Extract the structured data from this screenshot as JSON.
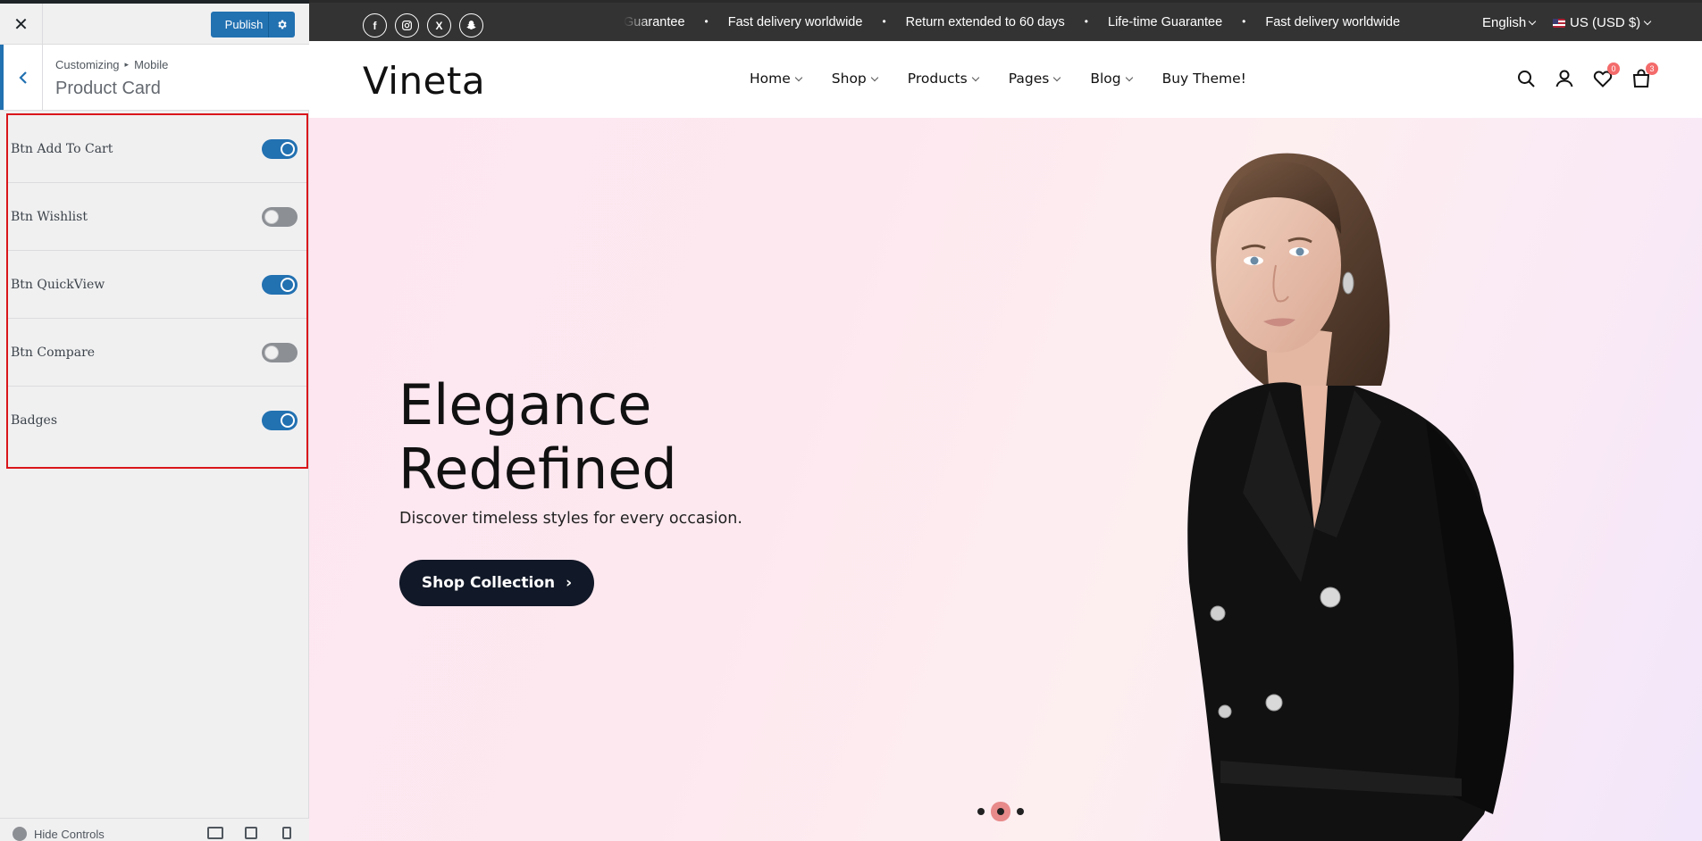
{
  "sidebar": {
    "close_label": "✕",
    "publish_label": "Publish",
    "breadcrumb": {
      "root": "Customizing",
      "separator": "▸",
      "current": "Mobile"
    },
    "section_title": "Product Card",
    "controls": [
      {
        "label": "Btn Add To Cart",
        "checked": true
      },
      {
        "label": "Btn Wishlist",
        "checked": false
      },
      {
        "label": "Btn QuickView",
        "checked": true
      },
      {
        "label": "Btn Compare",
        "checked": false
      },
      {
        "label": "Badges",
        "checked": true
      }
    ],
    "footer": {
      "hide_controls": "Hide Controls"
    },
    "colors": {
      "accent": "#2271b1",
      "highlight_border": "#d9161b"
    }
  },
  "preview": {
    "topbar": {
      "social": [
        "f",
        "ig",
        "X",
        "sc"
      ],
      "marquee": [
        "Guarantee",
        "Fast delivery worldwide",
        "Return extended to 60 days",
        "Life-time Guarantee",
        "Fast delivery worldwide"
      ],
      "language": "English",
      "currency": "US (USD $)"
    },
    "header": {
      "logo": "Vineta",
      "nav": [
        "Home",
        "Shop",
        "Products",
        "Pages",
        "Blog",
        "Buy Theme!"
      ],
      "wishlist_count": "0",
      "cart_count": "3"
    },
    "hero": {
      "title_line1": "Elegance",
      "title_line2": "Redefined",
      "subtitle": "Discover timeless styles for every occasion.",
      "cta": "Shop Collection",
      "cta_icon": "›",
      "slides": 3,
      "active_slide": 2
    }
  }
}
